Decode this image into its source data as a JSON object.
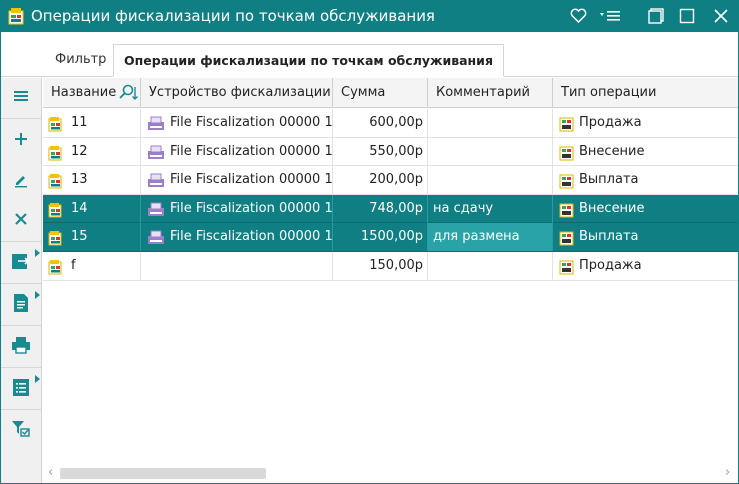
{
  "window": {
    "title": "Операции фискализации по точкам обслуживания",
    "accent_color": "#0f7f84",
    "icons": [
      "app-icon",
      "heart-icon",
      "menu-dropdown-icon",
      "restore-icon",
      "maximize-icon",
      "close-icon"
    ]
  },
  "tabs": [
    {
      "label": "Фильтр",
      "active": false
    },
    {
      "label": "Операции фискализации по точкам обслуживания",
      "active": true
    }
  ],
  "toolbar": {
    "icons": [
      "hamburger-icon",
      "add-icon",
      "edit-icon",
      "delete-icon",
      "export-icon",
      "document-icon",
      "print-icon",
      "list-icon",
      "filter-icon"
    ]
  },
  "grid": {
    "columns": [
      "Название",
      "Устройство фискализации",
      "Сумма",
      "Комментарий",
      "Тип операции"
    ],
    "sorted_column": "Название",
    "rows": [
      {
        "name": "11",
        "device": "File Fiscalization 00000 1",
        "sum": "600,00р",
        "comment": "",
        "type": "Продажа",
        "selected": false
      },
      {
        "name": "12",
        "device": "File Fiscalization 00000 1",
        "sum": "550,00р",
        "comment": "",
        "type": "Внесение",
        "selected": false
      },
      {
        "name": "13",
        "device": "File Fiscalization 00000 1",
        "sum": "200,00р",
        "comment": "",
        "type": "Выплата",
        "selected": false
      },
      {
        "name": "14",
        "device": "File Fiscalization 00000 1",
        "sum": "748,00р",
        "comment": "на сдачу",
        "type": "Внесение",
        "selected": true
      },
      {
        "name": "15",
        "device": "File Fiscalization 00000 1",
        "sum": "1500,00р",
        "comment": "для размена",
        "type": "Выплата",
        "selected": true
      },
      {
        "name": "f",
        "device": "",
        "sum": "150,00р",
        "comment": "",
        "type": "Продажа",
        "selected": false
      }
    ]
  },
  "scrollbar": {
    "left_arrow": "‹",
    "right_arrow": "›"
  }
}
